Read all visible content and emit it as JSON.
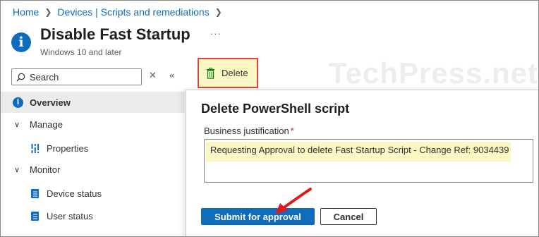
{
  "breadcrumb": [
    "Home",
    "Devices | Scripts and remediations"
  ],
  "page": {
    "title": "Disable Fast Startup",
    "subtitle": "Windows 10 and later",
    "more": "···",
    "info_icon": "i"
  },
  "watermark": "TechPress.net",
  "search": {
    "placeholder": "Search",
    "clear": "✕",
    "collapse": "«"
  },
  "toolbar": {
    "delete_label": "Delete"
  },
  "nav": {
    "overview": "Overview",
    "manage": "Manage",
    "properties": "Properties",
    "monitor": "Monitor",
    "device_status": "Device status",
    "user_status": "User status",
    "chevron": "∨"
  },
  "dialog": {
    "title": "Delete PowerShell script",
    "field_label": "Business justification",
    "required_mark": "*",
    "justification": "Requesting Approval to delete Fast Startup Script - Change Ref: 9034439",
    "submit_label": "Submit for approval",
    "cancel_label": "Cancel"
  },
  "colors": {
    "accent": "#0f6cbd",
    "highlight": "#fbf7c4",
    "annotation": "#d9443f",
    "arrow": "#e01a1a"
  },
  "icons": [
    "info-icon",
    "search-icon",
    "clear-icon",
    "collapse-icon",
    "trash-icon",
    "chevron-down-icon",
    "properties-icon",
    "device-status-icon",
    "user-status-icon",
    "annotation-arrow-icon"
  ]
}
